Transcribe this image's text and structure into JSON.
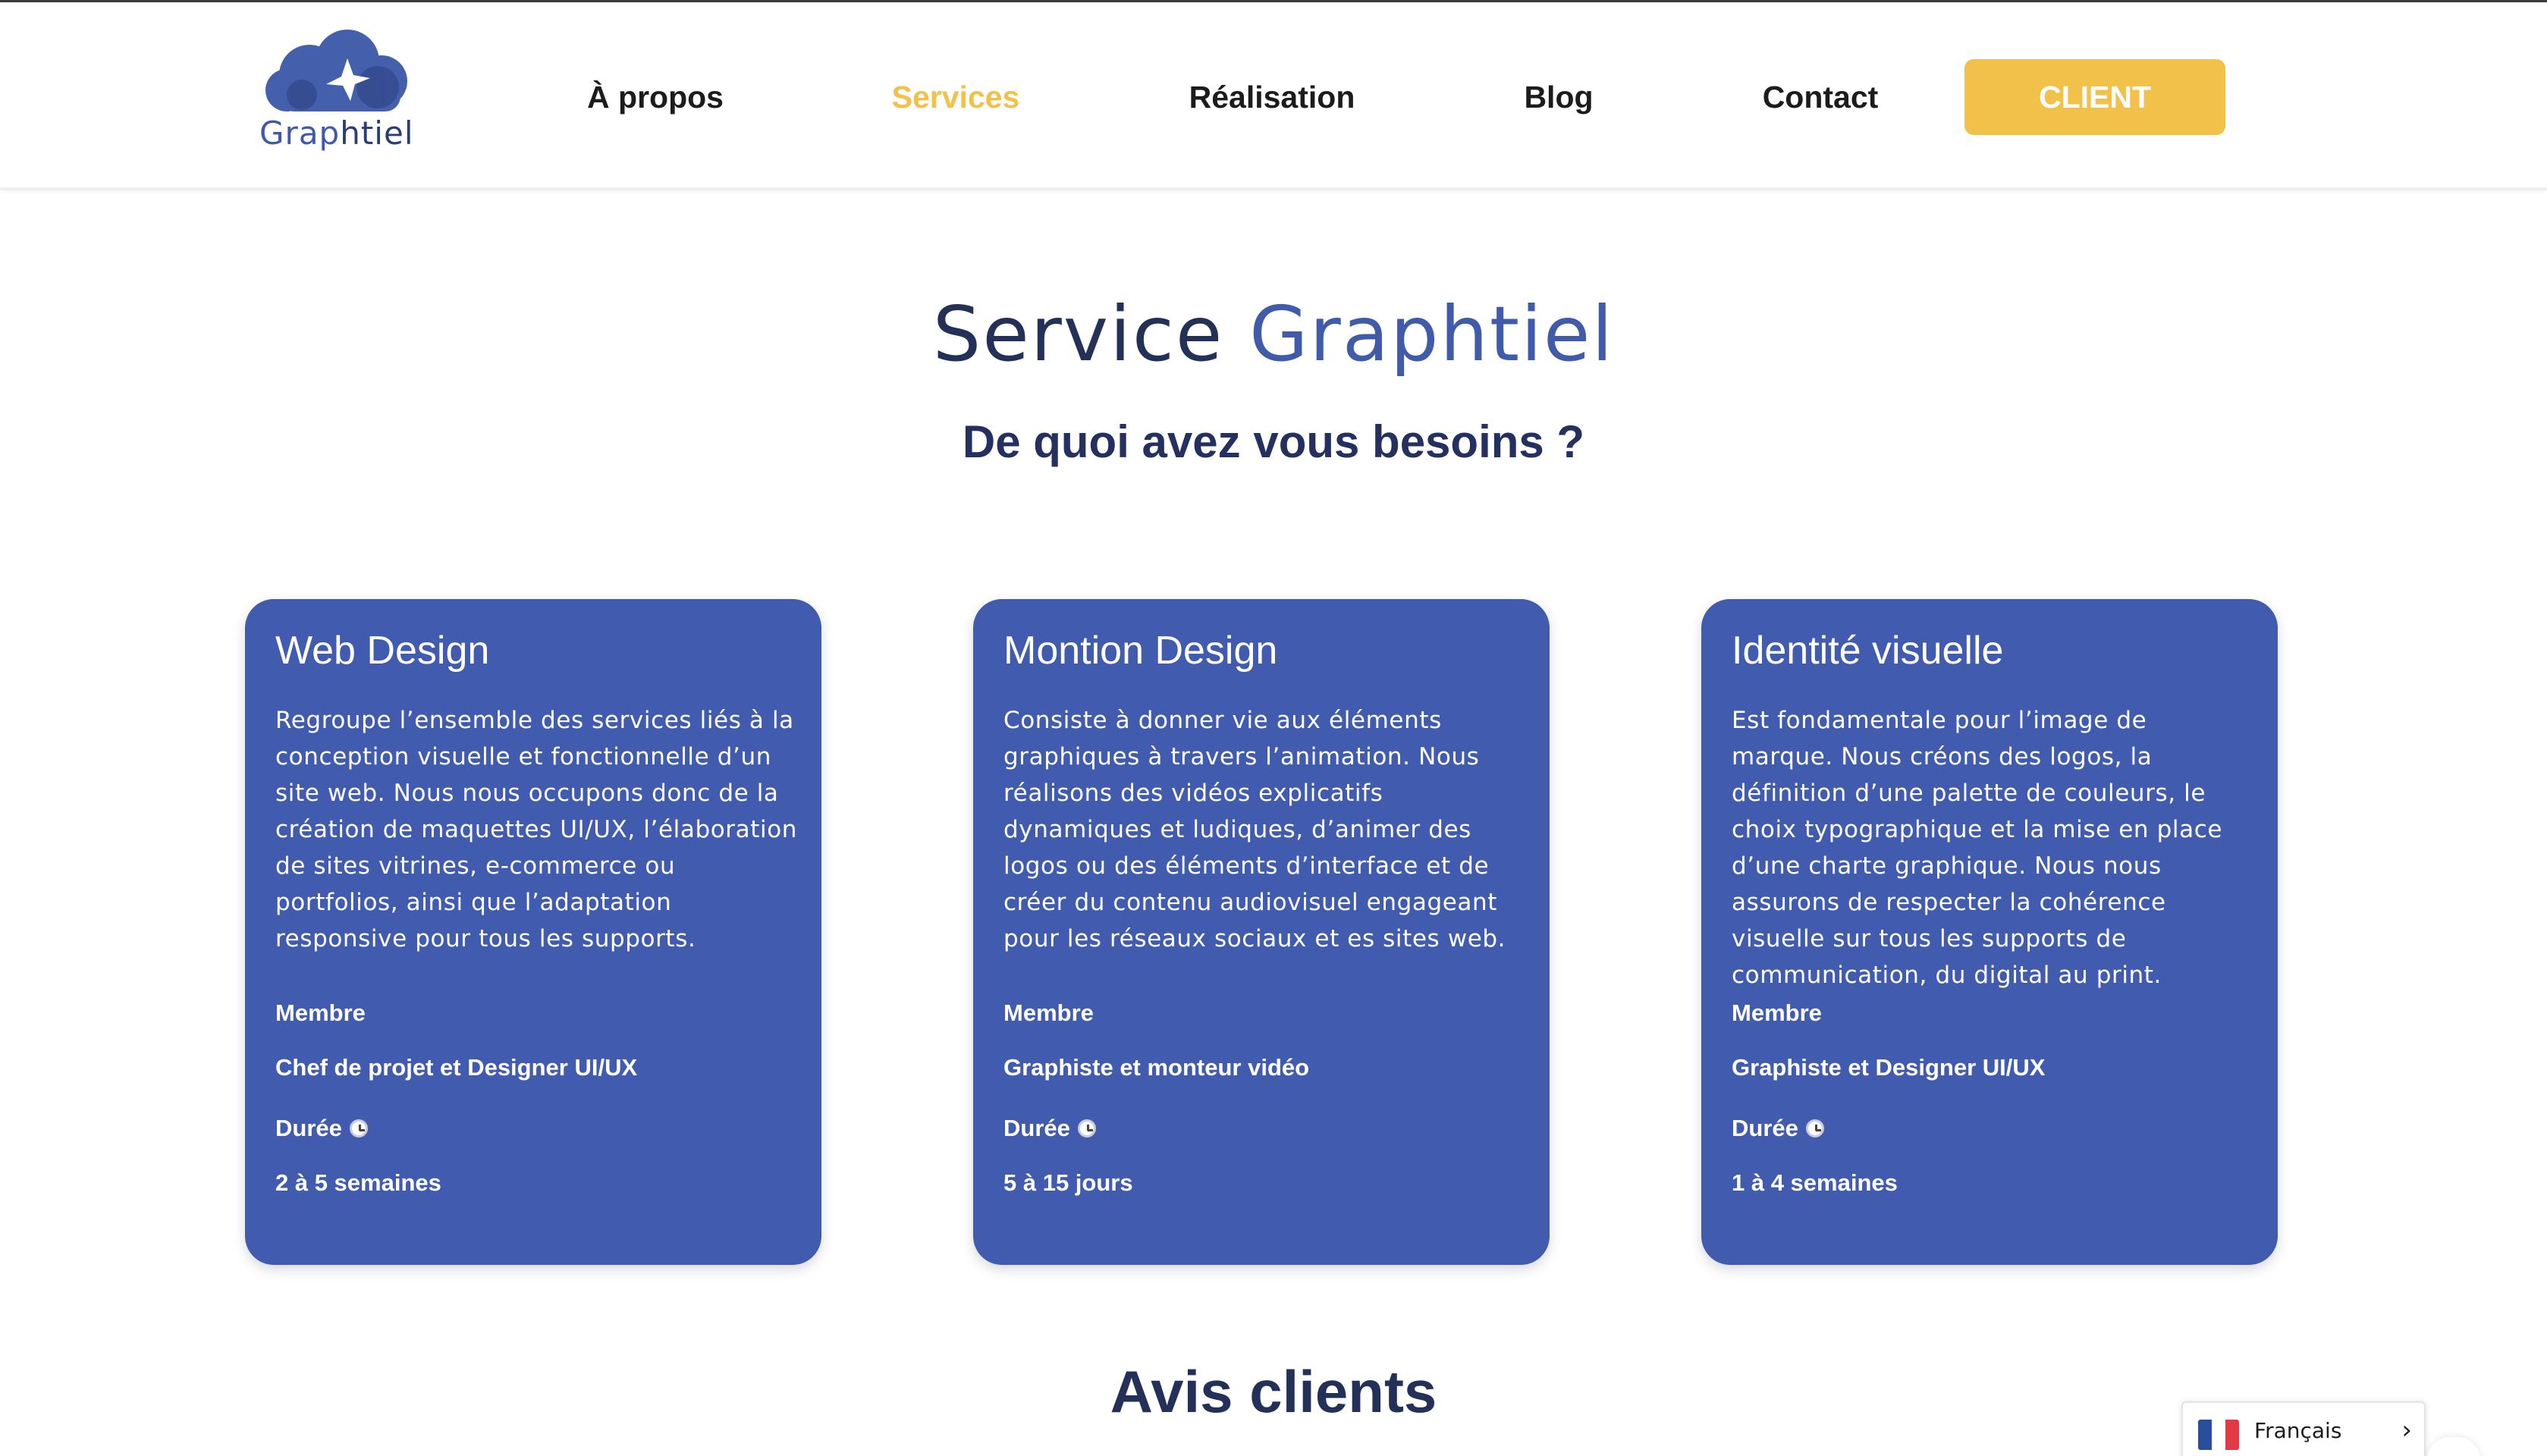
{
  "header": {
    "logo_text_left": "Grap",
    "logo_text_right": "htiel",
    "logo_text_mid": "h",
    "nav": [
      {
        "label": "À propos",
        "active": false
      },
      {
        "label": "Services",
        "active": true
      },
      {
        "label": "Réalisation",
        "active": false
      },
      {
        "label": "Blog",
        "active": false
      },
      {
        "label": "Contact",
        "active": false
      }
    ],
    "client_button": "CLIENT"
  },
  "hero": {
    "title_part1": "Service",
    "title_part2": "Graphtiel",
    "subtitle": "De quoi avez vous besoins ?"
  },
  "services": [
    {
      "title": "Web Design",
      "description": "Regroupe l’ensemble des services liés à la conception visuelle et fonctionnelle d’un site web. Nous nous occupons donc de la création de maquettes UI/UX, l’élaboration de sites vitrines, e-commerce ou portfolios, ainsi que l’adaptation responsive pour tous les supports.",
      "member_label": "Membre",
      "member": "Chef de projet et Designer UI/UX",
      "duration_label": "Durée",
      "duration": "2 à 5 semaines"
    },
    {
      "title": "Montion Design",
      "description": "Consiste à donner vie aux éléments graphiques à travers l’animation. Nous réalisons des vidéos explicatifs dynamiques et ludiques, d’animer des logos ou des éléments d’interface et de créer du contenu audiovisuel engageant pour les réseaux sociaux et es sites web.",
      "member_label": "Membre",
      "member": "Graphiste et monteur vidéo",
      "duration_label": "Durée",
      "duration": "5 à 15 jours"
    },
    {
      "title": "Identité visuelle",
      "description": "Est fondamentale pour l’image de marque. Nous créons des logos, la définition d’une palette de couleurs, le choix typographique et la mise en place d’une charte graphique. Nous nous assurons de respecter la cohérence visuelle sur tous les supports de communication, du digital au print.",
      "member_label": "Membre",
      "member": "Graphiste et Designer UI/UX",
      "duration_label": "Durée",
      "duration": "1 à 4 semaines"
    }
  ],
  "reviews": {
    "title": "Avis clients"
  },
  "language": {
    "selected": "Français",
    "flag_colors": [
      "#2a4d9c",
      "#ffffff",
      "#e23a44"
    ]
  },
  "colors": {
    "accent": "#f2c14a",
    "card": "#415cae",
    "navy": "#233058"
  }
}
